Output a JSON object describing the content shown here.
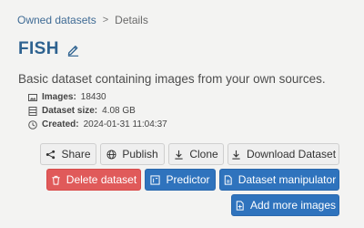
{
  "breadcrumb": {
    "parent": "Owned datasets",
    "separator": ">",
    "current": "Details"
  },
  "dataset": {
    "title": "FISH",
    "description": "Basic dataset containing images from your own sources.",
    "images_label": "Images:",
    "images_value": "18430",
    "size_label": "Dataset size:",
    "size_value": "4.08 GB",
    "created_label": "Created:",
    "created_value": "2024-01-31 11:04:37"
  },
  "actions": {
    "share": "Share",
    "publish": "Publish",
    "clone": "Clone",
    "download": "Download Dataset",
    "delete": "Delete dataset",
    "predictor": "Predictor",
    "manipulator": "Dataset manipulator",
    "add_images": "Add more images"
  },
  "colors": {
    "accent": "#2e6290",
    "primary_button": "#2f73bd",
    "danger_button": "#e05a5a",
    "background": "#f3f3f2"
  },
  "icons": {
    "edit": "pencil-icon",
    "images": "image-icon",
    "size": "database-icon",
    "created": "clock-icon",
    "share": "share-icon",
    "publish": "globe-icon",
    "clone": "download-arrow-icon",
    "download": "download-arrow-icon",
    "delete": "trash-icon",
    "predictor": "predictor-icon",
    "manipulator": "file-icon",
    "add_images": "file-plus-icon"
  }
}
